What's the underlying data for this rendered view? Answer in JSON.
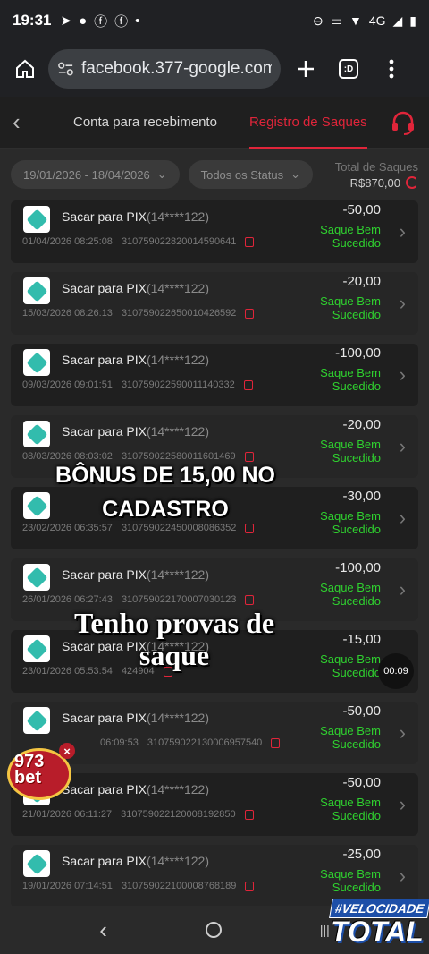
{
  "statusbar": {
    "time": "19:31",
    "network": "4G"
  },
  "browser": {
    "url": "facebook.377-google.com/",
    "tab_count": ":D"
  },
  "tabs": {
    "receive": "Conta para recebimento",
    "withdrawals": "Registro de Saques"
  },
  "filters": {
    "date_range": "19/01/2026 - 18/04/2026",
    "status": "Todos os Status",
    "total_label": "Total de Saques",
    "total_amount": "R$870,00"
  },
  "withdrawals": [
    {
      "title": "Sacar para PIX",
      "account": "(14****122)",
      "datetime": "01/04/2026 08:25:08",
      "id": "310759022820014590641",
      "amount": "-50,00",
      "status_1": "Saque Bem",
      "status_2": "Sucedido"
    },
    {
      "title": "Sacar para PIX",
      "account": "(14****122)",
      "datetime": "15/03/2026 08:26:13",
      "id": "310759022650010426592",
      "amount": "-20,00",
      "status_1": "Saque Bem",
      "status_2": "Sucedido"
    },
    {
      "title": "Sacar para PIX",
      "account": "(14****122)",
      "datetime": "09/03/2026 09:01:51",
      "id": "310759022590011140332",
      "amount": "-100,00",
      "status_1": "Saque Bem",
      "status_2": "Sucedido"
    },
    {
      "title": "Sacar para PIX",
      "account": "(14****122)",
      "datetime": "08/03/2026 08:03:02",
      "id": "310759022580011601469",
      "amount": "-20,00",
      "status_1": "Saque Bem",
      "status_2": "Sucedido"
    },
    {
      "title": "",
      "account": "",
      "datetime": "23/02/2026 06:35:57",
      "id": "310759022450008086352",
      "amount": "-30,00",
      "status_1": "Saque Bem",
      "status_2": "Sucedido"
    },
    {
      "title": "Sacar para PIX",
      "account": "(14****122)",
      "datetime": "26/01/2026 06:27:43",
      "id": "310759022170007030123",
      "amount": "-100,00",
      "status_1": "Saque Bem",
      "status_2": "Sucedido"
    },
    {
      "title": "Sacar para PIX",
      "account": "(14****122)",
      "datetime": "23/01/2026 05:53:54",
      "id": "424904",
      "amount": "-15,00",
      "status_1": "Saque Bem",
      "status_2": "Sucedido"
    },
    {
      "title": "Sacar para PIX",
      "account": "(14****122)",
      "datetime": "06:09:53",
      "id": "310759022130006957540",
      "amount": "-50,00",
      "status_1": "Saque Bem",
      "status_2": "Sucedido"
    },
    {
      "title": "Sacar para PIX",
      "account": "(14****122)",
      "datetime": "21/01/2026 06:11:27",
      "id": "310759022120008192850",
      "amount": "-50,00",
      "status_1": "Saque Bem",
      "status_2": "Sucedido"
    },
    {
      "title": "Sacar para PIX",
      "account": "(14****122)",
      "datetime": "19/01/2026 07:14:51",
      "id": "310759022100008768189",
      "amount": "-25,00",
      "status_1": "Saque Bem",
      "status_2": "Sucedido"
    }
  ],
  "overlay": {
    "caption_1": "BÔNUS DE 15,00 NO CADASTRO",
    "caption_2": "Tenho provas de saque",
    "timer": "00:09"
  },
  "promo": {
    "brand_1": "973",
    "brand_2": "bet"
  },
  "watermark": {
    "line_1": "#VELOCIDADE",
    "line_2": "TOTAL"
  },
  "colors": {
    "accent": "#e0253a",
    "success": "#2fd12f",
    "pix": "#32bcad"
  }
}
